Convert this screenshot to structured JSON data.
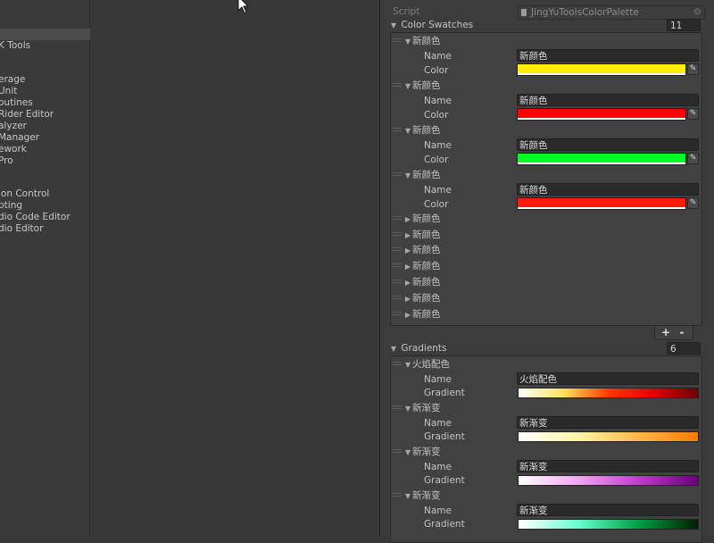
{
  "sidebar": {
    "items": [
      {
        "label": "",
        "selected": true
      },
      {
        "label": "K Tools",
        "selected": false
      },
      {
        "label": "erage",
        "selected": false
      },
      {
        "label": "Unit",
        "selected": false
      },
      {
        "label": "outines",
        "selected": false
      },
      {
        "label": "Rider Editor",
        "selected": false
      },
      {
        "label": "alyzer",
        "selected": false
      },
      {
        "label": "Manager",
        "selected": false
      },
      {
        "label": "ework",
        "selected": false
      },
      {
        "label": "Pro",
        "selected": false
      },
      {
        "label": "ion Control",
        "selected": false
      },
      {
        "label": "pting",
        "selected": false
      },
      {
        "label": "dio Code Editor",
        "selected": false
      },
      {
        "label": "dio Editor",
        "selected": false
      }
    ]
  },
  "inspector": {
    "script_label": "Script",
    "script_value": "JingYuToolsColorPalette",
    "color_swatches": {
      "label": "Color Swatches",
      "size": "11",
      "name_label": "Name",
      "color_label": "Color",
      "items": [
        {
          "title": "新颜色",
          "expanded": true,
          "name": "新颜色",
          "color": "#ffeb04"
        },
        {
          "title": "新颜色",
          "expanded": true,
          "name": "新颜色",
          "color": "#ff0000"
        },
        {
          "title": "新颜色",
          "expanded": true,
          "name": "新颜色",
          "color": "#00ff22"
        },
        {
          "title": "新颜色",
          "expanded": true,
          "name": "新颜色",
          "color": "#ff1a0a"
        },
        {
          "title": "新颜色",
          "expanded": false
        },
        {
          "title": "新颜色",
          "expanded": false
        },
        {
          "title": "新颜色",
          "expanded": false
        },
        {
          "title": "新颜色",
          "expanded": false
        },
        {
          "title": "新颜色",
          "expanded": false
        },
        {
          "title": "新颜色",
          "expanded": false
        },
        {
          "title": "新颜色",
          "expanded": false
        }
      ]
    },
    "list_buttons": {
      "add": "+",
      "remove": "-"
    },
    "gradients": {
      "label": "Gradients",
      "size": "6",
      "name_label": "Name",
      "gradient_label": "Gradient",
      "items": [
        {
          "title": "火焰配色",
          "name": "火焰配色",
          "stops": [
            "#ffffff",
            "#ffe35a",
            "#ff3a00",
            "#e80000",
            "#6a0000"
          ]
        },
        {
          "title": "新渐变",
          "name": "新渐变",
          "stops": [
            "#ffffff",
            "#fff3a8",
            "#ffb84a",
            "#ff7b00"
          ]
        },
        {
          "title": "新渐变",
          "name": "新渐变",
          "stops": [
            "#ffffff",
            "#f2a6f2",
            "#c23ccf",
            "#6a007a"
          ]
        },
        {
          "title": "新渐变",
          "name": "新渐变",
          "stops": [
            "#ffffff",
            "#66ffd0",
            "#00a040",
            "#002000"
          ]
        }
      ]
    }
  }
}
